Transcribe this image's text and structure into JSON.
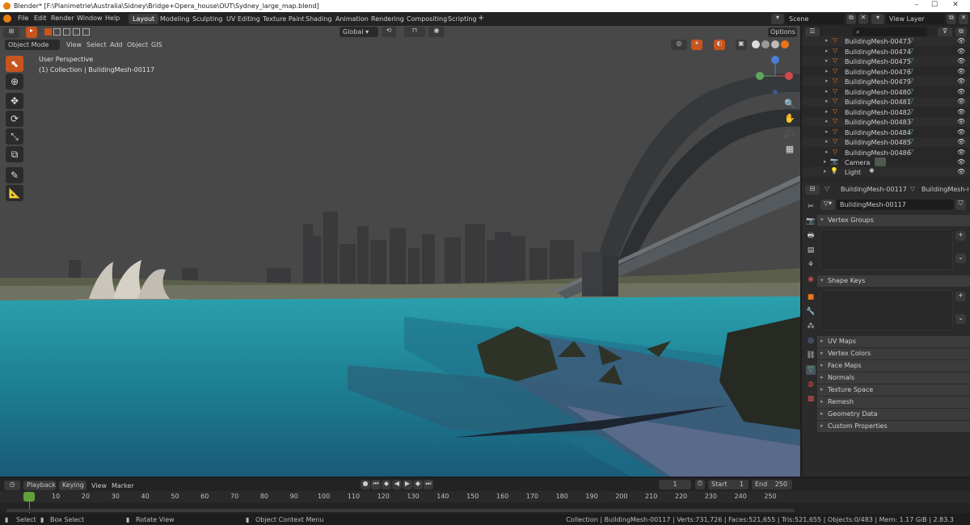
{
  "window": {
    "title": "Blender* [F:\\Planimetrie\\Australia\\Sidney\\Bridge+Opera_house\\OUT\\Sydney_large_map.blend]"
  },
  "menu": [
    "File",
    "Edit",
    "Render",
    "Window",
    "Help"
  ],
  "workspaces": [
    "Layout",
    "Modeling",
    "Sculpting",
    "UV Editing",
    "Texture Paint",
    "Shading",
    "Animation",
    "Rendering",
    "Compositing",
    "Scripting"
  ],
  "scene": {
    "name": "Scene",
    "view_layer": "View Layer"
  },
  "viewport": {
    "mode": "Object Mode",
    "header_menus": [
      "View",
      "Select",
      "Add",
      "Object",
      "GIS"
    ],
    "orientation": "Global",
    "options": "Options",
    "info_line1": "User Perspective",
    "info_line2": "(1) Collection | BuildingMesh-00117"
  },
  "outliner": {
    "items": [
      "BuildingMesh-00473",
      "BuildingMesh-00474",
      "BuildingMesh-00475",
      "BuildingMesh-00476",
      "BuildingMesh-00479",
      "BuildingMesh-00480",
      "BuildingMesh-00481",
      "BuildingMesh-00482",
      "BuildingMesh-00483",
      "BuildingMesh-00484",
      "BuildingMesh-00485",
      "BuildingMesh-00486"
    ],
    "camera": "Camera",
    "light": "Light"
  },
  "properties": {
    "breadcrumb_object": "BuildingMesh-00117",
    "breadcrumb_data": "BuildingMesh-00117",
    "data_name": "BuildingMesh-00117",
    "sections_open": [
      "Vertex Groups",
      "Shape Keys"
    ],
    "sections_closed": [
      "UV Maps",
      "Vertex Colors",
      "Face Maps",
      "Normals",
      "Texture Space",
      "Remesh",
      "Geometry Data",
      "Custom Properties"
    ]
  },
  "timeline": {
    "playback": "Playback",
    "keying": "Keying",
    "view": "View",
    "marker": "Marker",
    "current_frame": "1",
    "start_label": "Start",
    "start": "1",
    "end_label": "End",
    "end": "250",
    "ticks": [
      "1",
      "10",
      "20",
      "30",
      "40",
      "50",
      "60",
      "70",
      "80",
      "90",
      "100",
      "110",
      "120",
      "130",
      "140",
      "150",
      "160",
      "170",
      "180",
      "190",
      "200",
      "210",
      "220",
      "230",
      "240",
      "250"
    ]
  },
  "status": {
    "select": "Select",
    "box_select": "Box Select",
    "rotate_view": "Rotate View",
    "context_menu": "Object Context Menu",
    "stats": "Collection | BuildingMesh-00117 | Verts:731,726 | Faces:521,655 | Tris:521,655 | Objects:0/483 | Mem: 1.17 GiB | 2.83.3"
  },
  "colors": {
    "accent": "#e8741a",
    "water": "#1f8a9a",
    "active_tool": "#c8541e"
  }
}
